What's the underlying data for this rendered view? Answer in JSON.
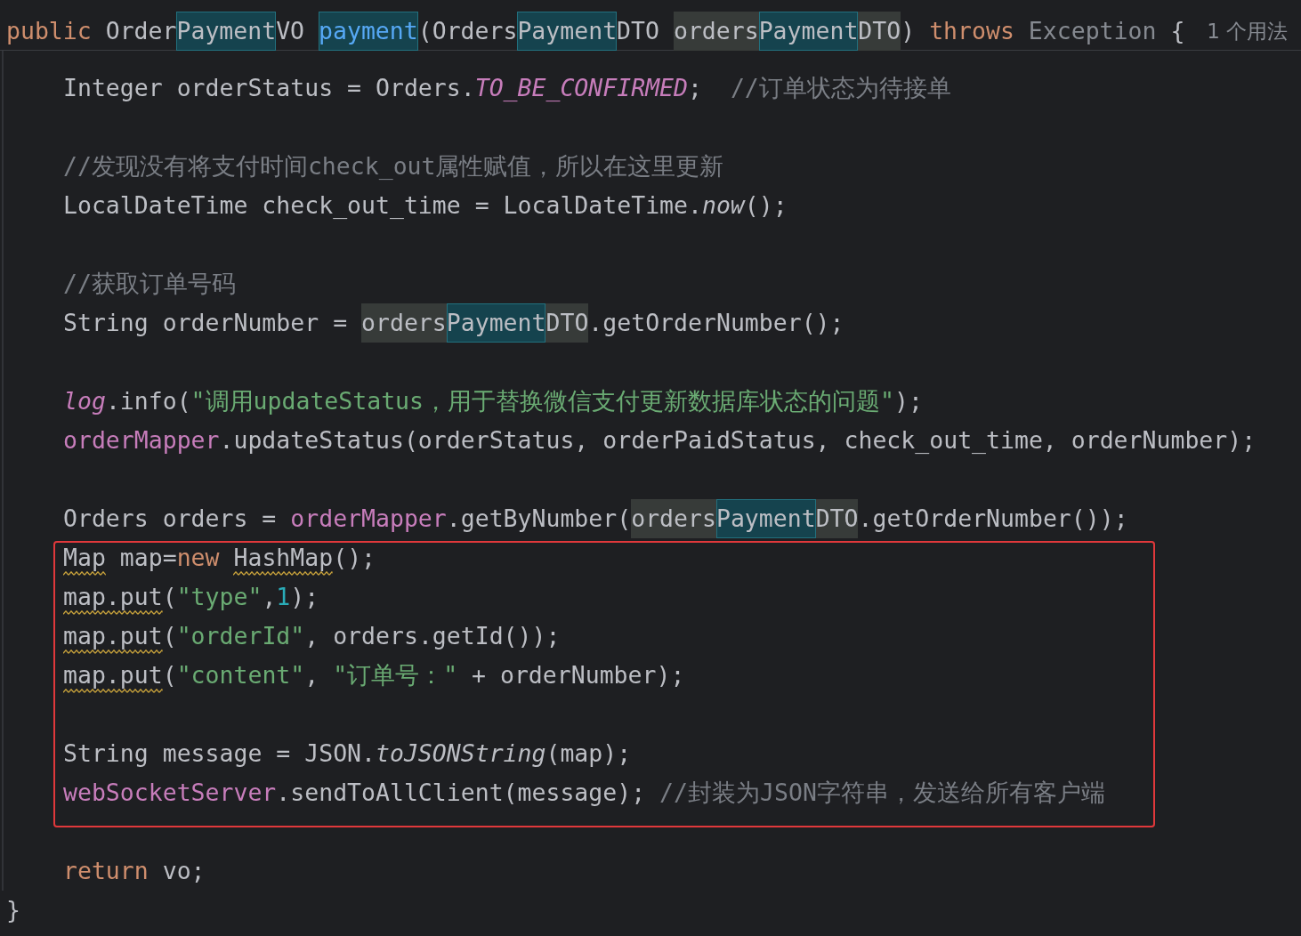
{
  "editor": {
    "sticky_header": {
      "tokens": [
        {
          "text": "public",
          "kind": "keyword"
        },
        {
          "text": " Order",
          "kind": "plain"
        },
        {
          "text": "Payment",
          "kind": "plain",
          "match": true
        },
        {
          "text": "VO ",
          "kind": "plain"
        },
        {
          "text": "payment",
          "kind": "method_decl",
          "match": true
        },
        {
          "text": "(Orders",
          "kind": "plain"
        },
        {
          "text": "Payment",
          "kind": "plain",
          "match": true
        },
        {
          "text": "DTO ",
          "kind": "plain"
        },
        {
          "text": "orders",
          "kind": "plain",
          "usage": true
        },
        {
          "text": "Payment",
          "kind": "plain",
          "match": true
        },
        {
          "text": "DTO",
          "kind": "plain",
          "usage": true
        },
        {
          "text": ") ",
          "kind": "plain"
        },
        {
          "text": "throws",
          "kind": "keyword"
        },
        {
          "text": " Exception",
          "kind": "dimmed"
        },
        {
          "text": " {",
          "kind": "plain"
        }
      ],
      "usage_hint": "1 个用法"
    },
    "body_blocks": [
      {
        "boxed": false,
        "lines": [
          {
            "kind": "code",
            "tokens": [
              {
                "text": "Integer orderStatus = Orders.",
                "kind": "plain"
              },
              {
                "text": "TO_BE_CONFIRMED",
                "kind": "constant"
              },
              {
                "text": ";  ",
                "kind": "plain"
              },
              {
                "text": "//订单状态为待接单",
                "kind": "comment"
              }
            ]
          },
          {
            "kind": "blank"
          },
          {
            "kind": "code",
            "tokens": [
              {
                "text": "//发现没有将支付时间check_out属性赋值，所以在这里更新",
                "kind": "comment"
              }
            ]
          },
          {
            "kind": "code",
            "tokens": [
              {
                "text": "LocalDateTime check_out_time = LocalDateTime.",
                "kind": "plain"
              },
              {
                "text": "now",
                "kind": "static_call"
              },
              {
                "text": "();",
                "kind": "plain"
              }
            ]
          },
          {
            "kind": "blank"
          },
          {
            "kind": "code",
            "tokens": [
              {
                "text": "//获取订单号码",
                "kind": "comment"
              }
            ]
          },
          {
            "kind": "code",
            "tokens": [
              {
                "text": "String orderNumber = ",
                "kind": "plain"
              },
              {
                "text": "orders",
                "kind": "plain",
                "usage": true
              },
              {
                "text": "Payment",
                "kind": "plain",
                "match": true
              },
              {
                "text": "DTO",
                "kind": "plain",
                "usage": true
              },
              {
                "text": ".getOrderNumber();",
                "kind": "plain"
              }
            ]
          },
          {
            "kind": "blank"
          },
          {
            "kind": "code",
            "tokens": [
              {
                "text": "log",
                "kind": "constant"
              },
              {
                "text": ".info(",
                "kind": "plain"
              },
              {
                "text": "\"调用updateStatus，用于替换微信支付更新数据库状态的问题\"",
                "kind": "string"
              },
              {
                "text": ");",
                "kind": "plain"
              }
            ]
          },
          {
            "kind": "code",
            "tokens": [
              {
                "text": "orderMapper",
                "kind": "field"
              },
              {
                "text": ".updateStatus(orderStatus, orderPaidStatus, check_out_time, orderNumber);",
                "kind": "plain"
              }
            ]
          },
          {
            "kind": "blank"
          },
          {
            "kind": "code",
            "tokens": [
              {
                "text": "Orders orders = ",
                "kind": "plain"
              },
              {
                "text": "orderMapper",
                "kind": "field"
              },
              {
                "text": ".getByNumber(",
                "kind": "plain"
              },
              {
                "text": "orders",
                "kind": "plain",
                "usage": true
              },
              {
                "text": "Payment",
                "kind": "plain",
                "match": true
              },
              {
                "text": "DTO",
                "kind": "plain",
                "usage": true
              },
              {
                "text": ".getOrderNumber());",
                "kind": "plain"
              }
            ]
          }
        ]
      },
      {
        "boxed": true,
        "lines": [
          {
            "kind": "code",
            "tokens": [
              {
                "text": "Map",
                "kind": "plain",
                "warning": true
              },
              {
                "text": " map=",
                "kind": "plain"
              },
              {
                "text": "new ",
                "kind": "keyword"
              },
              {
                "text": "HashMap",
                "kind": "plain",
                "warning": true
              },
              {
                "text": "();",
                "kind": "plain"
              }
            ]
          },
          {
            "kind": "code",
            "tokens": [
              {
                "text": "map.put",
                "kind": "plain",
                "warning": true
              },
              {
                "text": "(",
                "kind": "plain"
              },
              {
                "text": "\"type\"",
                "kind": "string"
              },
              {
                "text": ",",
                "kind": "plain"
              },
              {
                "text": "1",
                "kind": "number"
              },
              {
                "text": ");",
                "kind": "plain"
              }
            ]
          },
          {
            "kind": "code",
            "tokens": [
              {
                "text": "map.put",
                "kind": "plain",
                "warning": true
              },
              {
                "text": "(",
                "kind": "plain"
              },
              {
                "text": "\"orderId\"",
                "kind": "string"
              },
              {
                "text": ", orders.getId());",
                "kind": "plain"
              }
            ]
          },
          {
            "kind": "code",
            "tokens": [
              {
                "text": "map.put",
                "kind": "plain",
                "warning": true
              },
              {
                "text": "(",
                "kind": "plain"
              },
              {
                "text": "\"content\"",
                "kind": "string"
              },
              {
                "text": ", ",
                "kind": "plain"
              },
              {
                "text": "\"订单号：\"",
                "kind": "string"
              },
              {
                "text": " + orderNumber);",
                "kind": "plain"
              }
            ]
          },
          {
            "kind": "blank"
          },
          {
            "kind": "code",
            "tokens": [
              {
                "text": "String message = JSON.",
                "kind": "plain"
              },
              {
                "text": "toJSONString",
                "kind": "static_call"
              },
              {
                "text": "(map);",
                "kind": "plain"
              }
            ]
          },
          {
            "kind": "code",
            "tokens": [
              {
                "text": "webSocketServer",
                "kind": "field"
              },
              {
                "text": ".sendToAllClient(message); ",
                "kind": "plain"
              },
              {
                "text": "//封装为JSON字符串，发送给所有客户端",
                "kind": "comment"
              }
            ]
          }
        ]
      },
      {
        "boxed": false,
        "lines": [
          {
            "kind": "blank"
          },
          {
            "kind": "code",
            "tokens": [
              {
                "text": "return",
                "kind": "keyword"
              },
              {
                "text": " vo;",
                "kind": "plain"
              }
            ]
          }
        ]
      }
    ],
    "closing_line": {
      "tokens": [
        {
          "text": "}",
          "kind": "plain"
        }
      ]
    }
  }
}
